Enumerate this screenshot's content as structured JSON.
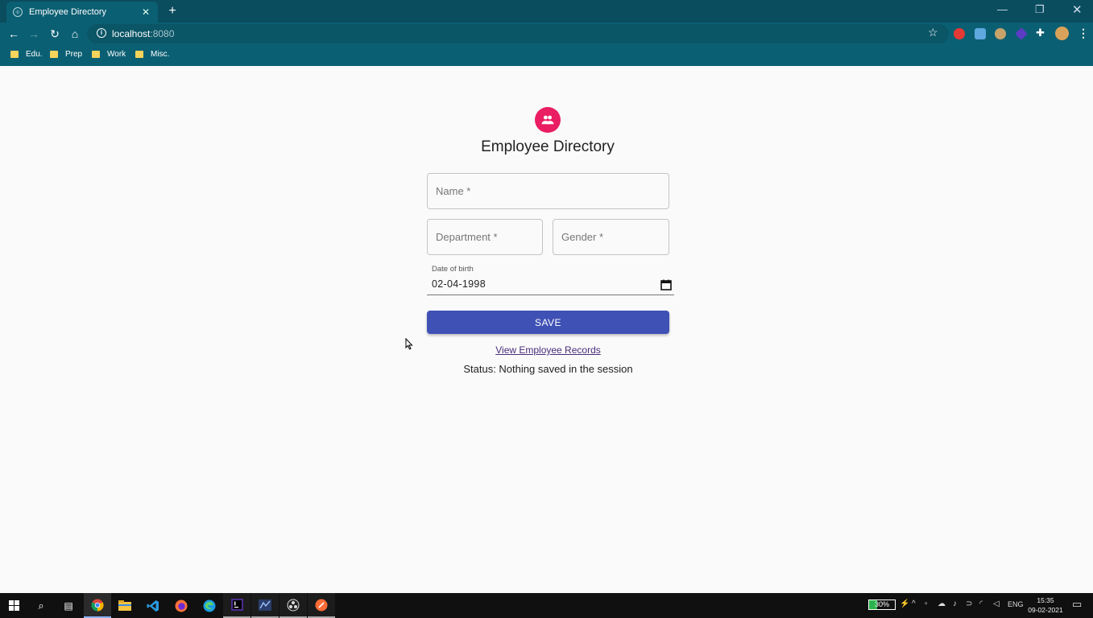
{
  "browser": {
    "tab_title": "Employee Directory",
    "new_tab_glyph": "+",
    "url_host": "localhost",
    "url_port": ":8080",
    "bookmarks": [
      {
        "label": "Edu."
      },
      {
        "label": "Prep"
      },
      {
        "label": "Work"
      },
      {
        "label": "Misc."
      }
    ]
  },
  "page": {
    "title": "Employee Directory",
    "avatar_icon": "people-icon",
    "avatar_color": "#e91e63",
    "form": {
      "name_placeholder": "Name *",
      "department_placeholder": "Department *",
      "gender_placeholder": "Gender *",
      "dob_label": "Date of birth",
      "dob_value": "02-04-1998",
      "save_label": "SAVE",
      "save_color": "#3f51b5"
    },
    "records_link": "View Employee Records",
    "status": "Status: Nothing saved in the session"
  },
  "taskbar": {
    "battery": "30%",
    "language": "ENG",
    "time": "15:35",
    "date": "09-02-2021"
  }
}
